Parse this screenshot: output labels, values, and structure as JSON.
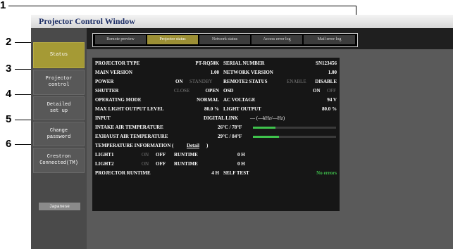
{
  "callouts": [
    "1",
    "2",
    "3",
    "4",
    "5",
    "6"
  ],
  "window": {
    "title": "Projector Control Window"
  },
  "sidebar": {
    "items": [
      {
        "label": "Status"
      },
      {
        "label": "Projector\ncontrol"
      },
      {
        "label": "Detailed\nset up"
      },
      {
        "label": "Change\npassword"
      },
      {
        "label": "Crestron\nConnected(TM)"
      }
    ],
    "language": "Japanese"
  },
  "tabs": [
    "Remote preview",
    "Projector status",
    "Network status",
    "Access error log",
    "Mail error log"
  ],
  "status": {
    "projector_type_label": "PROJECTOR TYPE",
    "projector_type": "PT-RQ50K",
    "serial_label": "SERIAL NUMBER",
    "serial": "SN123456",
    "main_version_label": "MAIN VERSION",
    "main_version": "1.00",
    "network_version_label": "NETWORK VERSION",
    "network_version": "1.00",
    "power_label": "POWER",
    "power_on": "ON",
    "power_standby": "STANDBY",
    "remote2_label": "REMOTE2 STATUS",
    "remote2_enable": "ENABLE",
    "remote2_disable": "DISABLE",
    "shutter_label": "SHUTTER",
    "shutter_close": "CLOSE",
    "shutter_open": "OPEN",
    "osd_label": "OSD",
    "osd_on": "ON",
    "osd_off": "OFF",
    "operating_mode_label": "OPERATING MODE",
    "operating_mode": "NORMAL",
    "ac_voltage_label": "AC VOLTAGE",
    "ac_voltage": "94 V",
    "max_light_label": "MAX LIGHT OUTPUT LEVEL",
    "max_light": "80.0 %",
    "light_output_label": "LIGHT OUTPUT",
    "light_output": "80.0 %",
    "input_label": "INPUT",
    "input_value": "DIGITAL LINK",
    "input_freq": "— (—kHz/—Hz)",
    "intake_label": "INTAKE AIR TEMPERATURE",
    "intake_value": "26°C / 78°F",
    "intake_level": 0.27,
    "exhaust_label": "EXHAUST AIR TEMPERATURE",
    "exhaust_value": "29°C / 84°F",
    "exhaust_level": 0.31,
    "temp_info_label": "TEMPERATURE INFORMATION (",
    "temp_info_link": "Detail",
    "temp_info_close": ")",
    "light1_label": "LIGHT1",
    "light1_on": "ON",
    "light1_off": "OFF",
    "light1_runtime_label": "RUNTIME",
    "light1_runtime": "0 H",
    "light2_label": "LIGHT2",
    "light2_on": "ON",
    "light2_off": "OFF",
    "light2_runtime_label": "RUNTIME",
    "light2_runtime": "0 H",
    "proj_runtime_label": "PROJECTOR RUNTIME",
    "proj_runtime": "4 H",
    "self_test_label": "SELF TEST",
    "self_test": "No errors"
  },
  "colors": {
    "accent": "#a59a35",
    "ok_green": "#3fc24c",
    "title_text": "#1d2e66"
  }
}
